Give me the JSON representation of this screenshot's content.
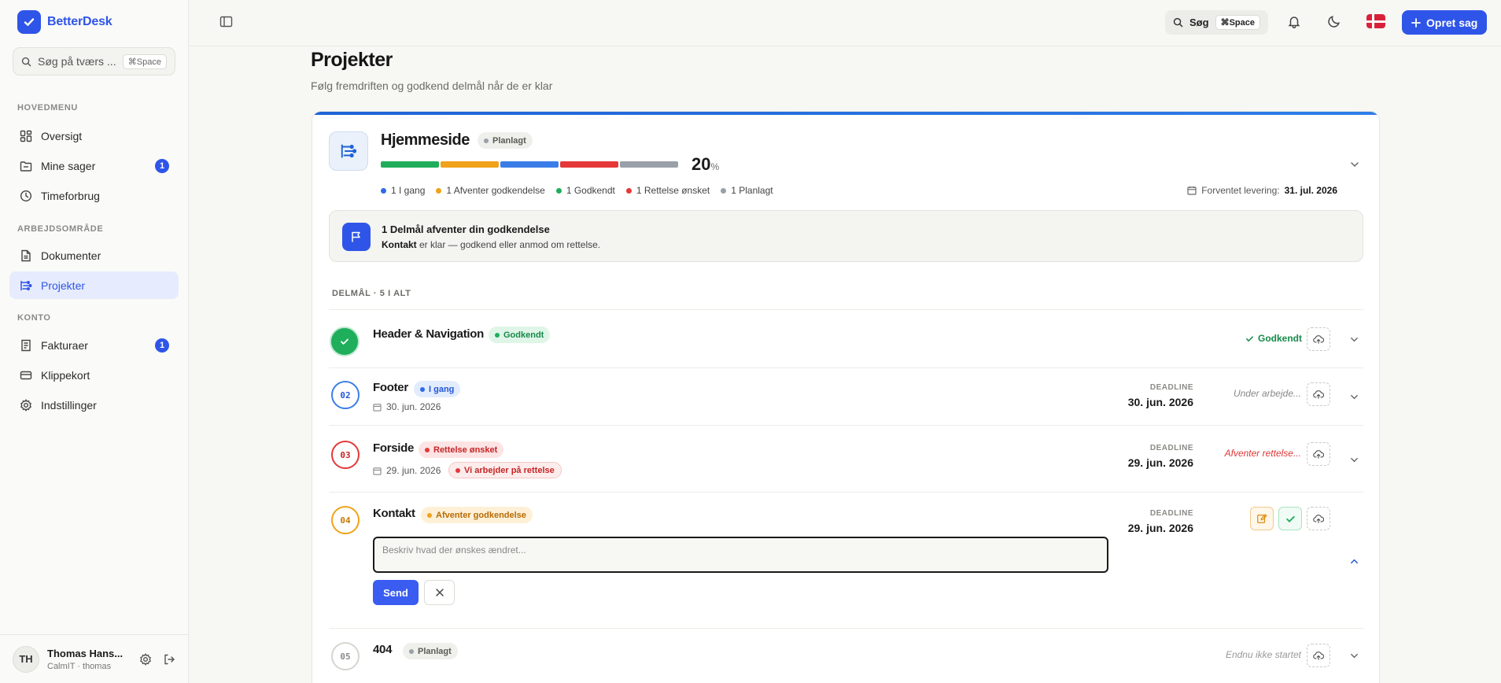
{
  "app": {
    "name": "BetterDesk"
  },
  "sidebar": {
    "search": {
      "placeholder": "Søg på tværs ...",
      "shortcut": "⌘Space"
    },
    "sections": [
      {
        "title": "HOVEDMENU"
      },
      {
        "title": "ARBEJDSOMRÅDE"
      },
      {
        "title": "KONTO"
      }
    ],
    "items": [
      {
        "label": "Oversigt",
        "icon": "grid-icon"
      },
      {
        "label": "Mine sager",
        "icon": "folder-icon",
        "badge": "1"
      },
      {
        "label": "Timeforbrug",
        "icon": "clock-icon"
      },
      {
        "label": "Dokumenter",
        "icon": "document-icon"
      },
      {
        "label": "Projekter",
        "icon": "projects-icon",
        "active": true
      },
      {
        "label": "Fakturaer",
        "icon": "invoice-icon",
        "badge": "1"
      },
      {
        "label": "Klippekort",
        "icon": "card-icon"
      },
      {
        "label": "Indstillinger",
        "icon": "gear-icon"
      }
    ],
    "user": {
      "initials": "TH",
      "name": "Thomas Hans...",
      "sub": "CalmIT · thomas"
    }
  },
  "topbar": {
    "search_label": "Søg",
    "search_shortcut": "⌘Space",
    "create_label": "Opret sag"
  },
  "page": {
    "title": "Projekter",
    "subtitle": "Følg fremdriften og godkend delmål når de er klar"
  },
  "project": {
    "name": "Hjemmeside",
    "status": "Planlagt",
    "progress_percent": "20",
    "percent_sign": "%",
    "segments": [
      "#1fae5b",
      "#f0a21a",
      "#3b7de8",
      "#e53838",
      "#9aa0a8"
    ],
    "legend": [
      {
        "label": "1 I gang",
        "color": "#2f6ae8"
      },
      {
        "label": "1 Afventer godkendelse",
        "color": "#f0a21a"
      },
      {
        "label": "1 Godkendt",
        "color": "#1fae5b"
      },
      {
        "label": "1 Rettelse ønsket",
        "color": "#e53838"
      },
      {
        "label": "1 Planlagt",
        "color": "#9aa0a8"
      }
    ],
    "delivery_label": "Forventet levering:",
    "delivery_date": "31. jul. 2026",
    "approval": {
      "title": "1 Delmål afventer din godkendelse",
      "task": "Kontakt",
      "rest": " er klar — godkend eller anmod om rettelse."
    },
    "subhead": "DELMÅL · 5 I ALT",
    "tasks": [
      {
        "num": "",
        "name": "Header & Navigation",
        "status": "Godkendt",
        "right_note": "Godkendt"
      },
      {
        "num": "02",
        "name": "Footer",
        "status": "I gang",
        "date": "30. jun. 2026",
        "deadline_label": "DEADLINE",
        "deadline": "30. jun. 2026",
        "right_note": "Under arbejde..."
      },
      {
        "num": "03",
        "name": "Forside",
        "status": "Rettelse ønsket",
        "date": "29. jun. 2026",
        "extra_badge": "Vi arbejder på rettelse",
        "deadline_label": "DEADLINE",
        "deadline": "29. jun. 2026",
        "right_note": "Afventer rettelse..."
      },
      {
        "num": "04",
        "name": "Kontakt",
        "status": "Afventer godkendelse",
        "deadline_label": "DEADLINE",
        "deadline": "29. jun. 2026",
        "textarea_placeholder": "Beskriv hvad der ønskes ændret...",
        "send_label": "Send"
      },
      {
        "num": "05",
        "name": "404",
        "status": "Planlagt",
        "right_note": "Endnu ikke startet"
      }
    ]
  }
}
